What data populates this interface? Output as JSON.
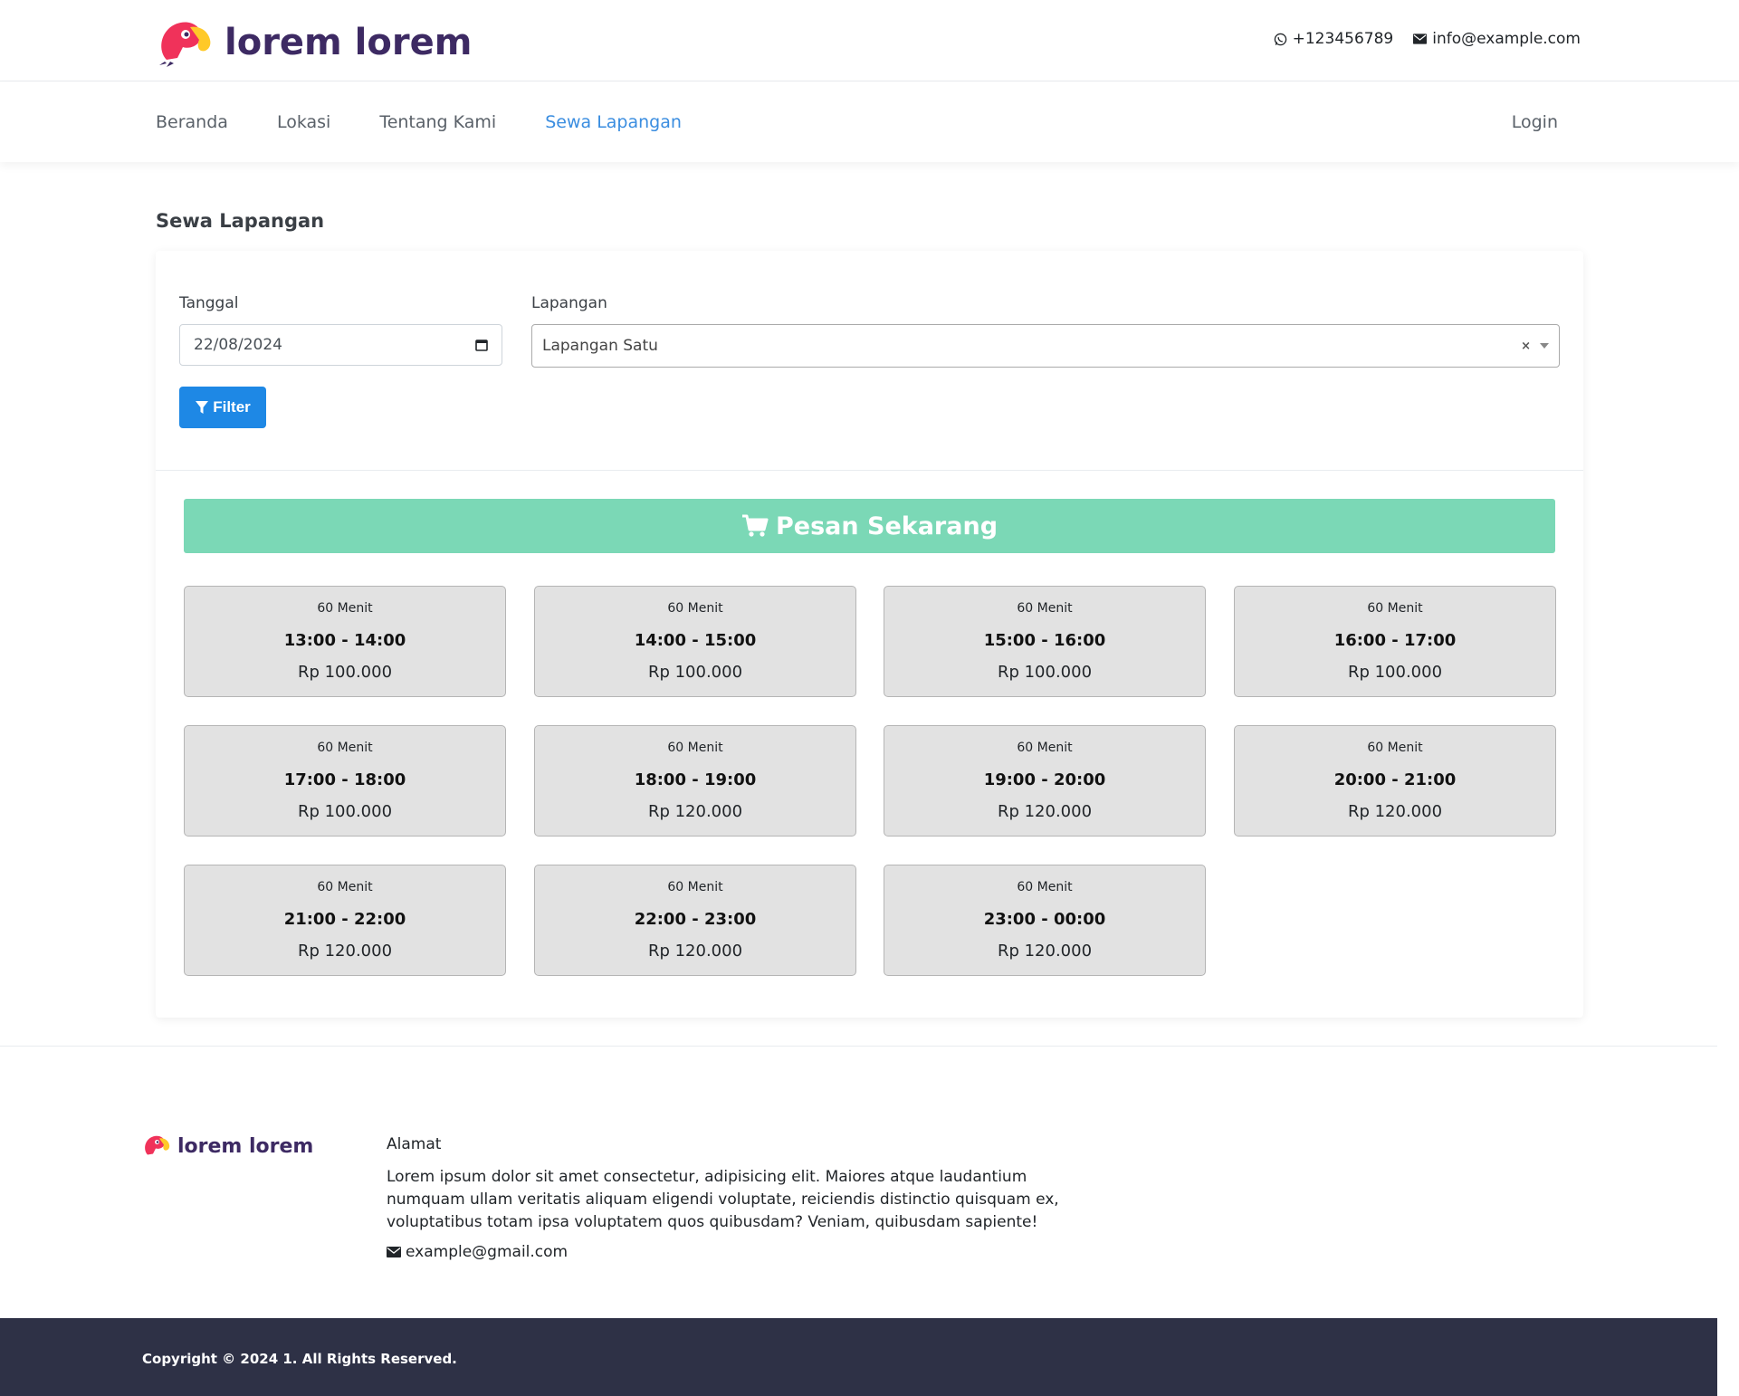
{
  "header": {
    "brand": "lorem lorem",
    "phone": "+123456789",
    "email": "info@example.com"
  },
  "nav": {
    "items": [
      {
        "label": "Beranda"
      },
      {
        "label": "Lokasi"
      },
      {
        "label": "Tentang Kami"
      },
      {
        "label": "Sewa Lapangan"
      }
    ],
    "active": "Sewa Lapangan",
    "login": "Login"
  },
  "page": {
    "title": "Sewa Lapangan"
  },
  "form": {
    "date_label": "Tanggal",
    "date_value": "22/08/2024",
    "field_label": "Lapangan",
    "field_value": "Lapangan Satu",
    "clear": "×",
    "filter_label": "Filter"
  },
  "order": {
    "label": "Pesan Sekarang"
  },
  "slots": [
    {
      "duration": "60 Menit",
      "time": "13:00 - 14:00",
      "price": "Rp 100.000"
    },
    {
      "duration": "60 Menit",
      "time": "14:00 - 15:00",
      "price": "Rp 100.000"
    },
    {
      "duration": "60 Menit",
      "time": "15:00 - 16:00",
      "price": "Rp 100.000"
    },
    {
      "duration": "60 Menit",
      "time": "16:00 - 17:00",
      "price": "Rp 100.000"
    },
    {
      "duration": "60 Menit",
      "time": "17:00 - 18:00",
      "price": "Rp 100.000"
    },
    {
      "duration": "60 Menit",
      "time": "18:00 - 19:00",
      "price": "Rp 120.000"
    },
    {
      "duration": "60 Menit",
      "time": "19:00 - 20:00",
      "price": "Rp 120.000"
    },
    {
      "duration": "60 Menit",
      "time": "20:00 - 21:00",
      "price": "Rp 120.000"
    },
    {
      "duration": "60 Menit",
      "time": "21:00 - 22:00",
      "price": "Rp 120.000"
    },
    {
      "duration": "60 Menit",
      "time": "22:00 - 23:00",
      "price": "Rp 120.000"
    },
    {
      "duration": "60 Menit",
      "time": "23:00 - 00:00",
      "price": "Rp 120.000"
    }
  ],
  "footer": {
    "brand": "lorem lorem",
    "heading": "Alamat",
    "address": "Lorem ipsum dolor sit amet consectetur, adipisicing elit. Maiores atque laudantium numquam ullam veritatis aliquam eligendi voluptate, reiciendis distinctio quisquam ex, voluptatibus totam ipsa voluptatem quos quibusdam? Veniam, quibusdam sapiente!",
    "email": "example@gmail.com",
    "copyright": "Copyright © 2024 1. All Rights Reserved."
  },
  "colors": {
    "brand": "#3d2a63",
    "accent": "#1e88e5",
    "active_nav": "#3a8de0",
    "order_button": "#7bd8b6",
    "footer_bar": "#2e3146"
  }
}
